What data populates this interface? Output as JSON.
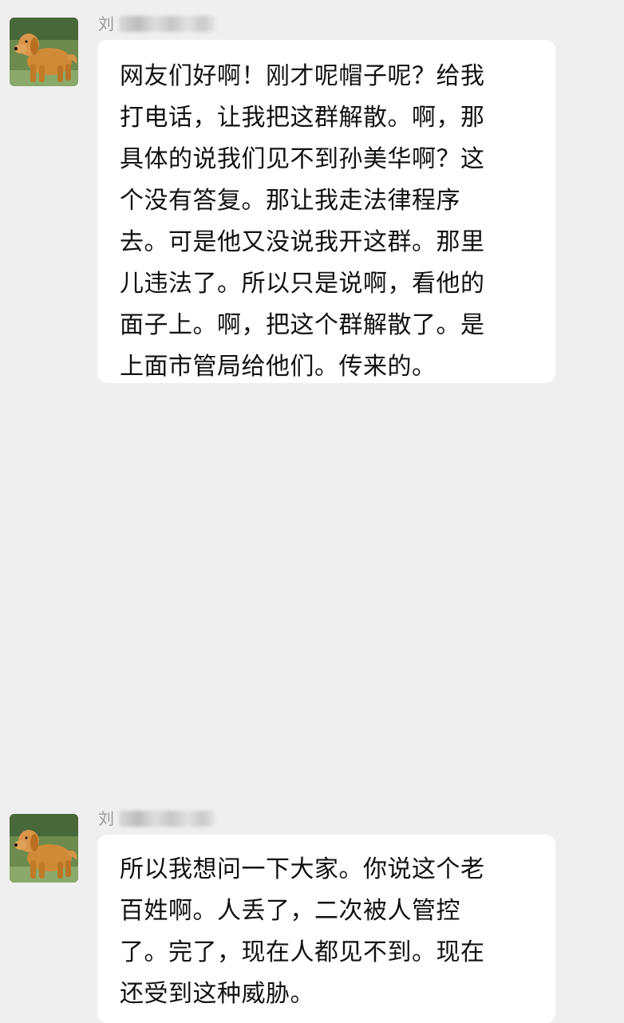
{
  "messages": [
    {
      "sender": {
        "name": "刘"
      },
      "avatar": {
        "icon": "golden-retriever-avatar"
      },
      "text": "网友们好啊！刚才呢帽子呢？给我\n打电话，让我把这群解散。啊，那\n具体的说我们见不到孙美华啊？这\n个没有答复。那让我走法律程序\n去。可是他又没说我开这群。那里\n儿违法了。所以只是说啊，看他的\n面子上。啊，把这个群解散了。是\n上面市管局给他们。传来的。"
    },
    {
      "sender": {
        "name": "刘"
      },
      "avatar": {
        "icon": "golden-retriever-avatar"
      },
      "text": "所以我想问一下大家。你说这个老\n百姓啊。人丢了，二次被人管控\n了。完了，现在人都见不到。现在\n还受到这种威胁。"
    }
  ],
  "colors": {
    "background": "#efefef",
    "bubble": "#ffffff",
    "text": "#111111",
    "sender": "#9a9a9a"
  }
}
